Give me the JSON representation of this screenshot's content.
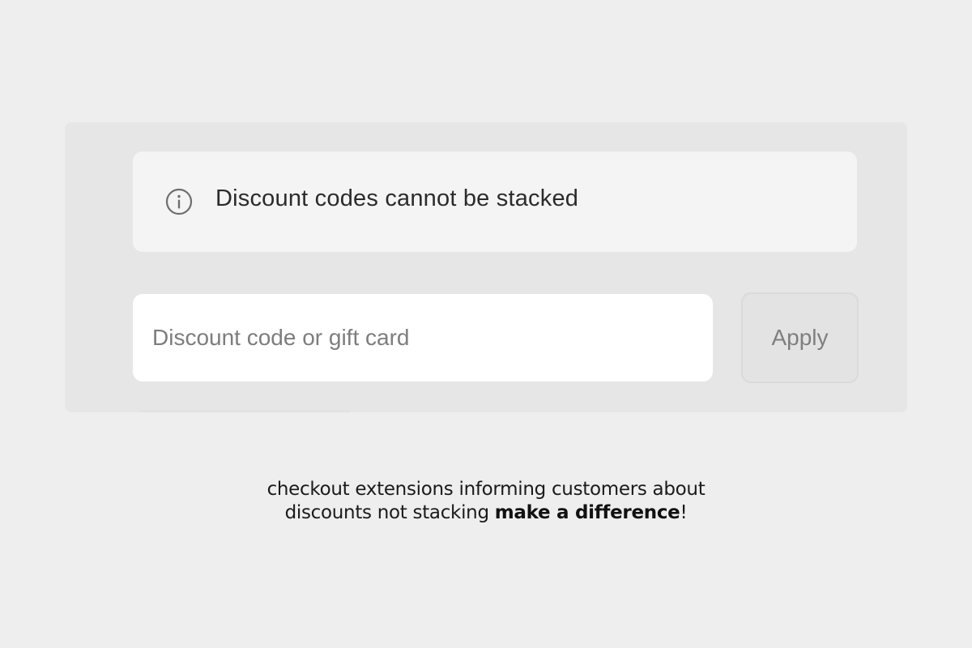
{
  "notice": {
    "icon": "info-icon",
    "text": "Discount codes cannot be stacked"
  },
  "discount_form": {
    "input_placeholder": "Discount code or gift card",
    "input_value": "",
    "apply_label": "Apply"
  },
  "caption": {
    "line1": "checkout extensions informing customers about",
    "line2_prefix": "discounts not stacking ",
    "line2_bold": "make a difference",
    "line2_suffix": "!"
  },
  "colors": {
    "page_background": "#eeeeee",
    "panel_background": "#e6e6e6",
    "notice_background": "#f4f4f4",
    "input_background": "#ffffff",
    "button_background": "#e3e3e3",
    "button_text": "#7f7f7f",
    "placeholder_text": "#7d7d7d",
    "body_text": "#2b2b2b"
  }
}
